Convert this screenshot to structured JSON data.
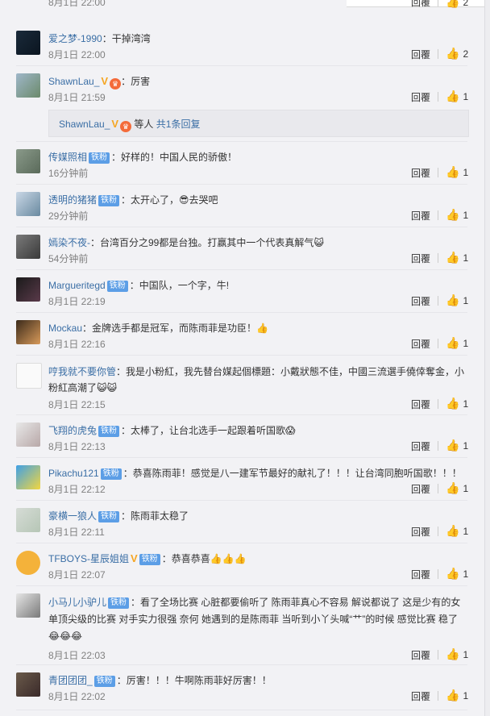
{
  "top_partial": {
    "time": "8月1日 22:00",
    "reply_label": "回覆",
    "like_count": "2"
  },
  "comments": [
    {
      "user": "爱之梦-1990",
      "v": false,
      "crown": false,
      "badge": "",
      "text": "：干掉湾湾",
      "time": "8月1日 22:00",
      "reply": "回覆",
      "likes": "2"
    },
    {
      "user": "ShawnLau_",
      "v": true,
      "crown": true,
      "badge": "",
      "text": "：厉害",
      "time": "8月1日 21:59",
      "reply": "回覆",
      "likes": "1"
    },
    {
      "user": "传媒照相",
      "v": false,
      "crown": false,
      "badge": "铁粉",
      "text": "：好样的！中国人民的骄傲！",
      "time": "16分钟前",
      "reply": "回覆",
      "likes": "1"
    },
    {
      "user": "透明的猪猪",
      "v": false,
      "crown": false,
      "badge": "铁粉",
      "text": "：太开心了，😎去哭吧",
      "time": "29分钟前",
      "reply": "回覆",
      "likes": "1"
    },
    {
      "user": "嫣染不夜-",
      "v": false,
      "crown": false,
      "badge": "",
      "text": "：台湾百分之99都是台独。打赢其中一个代表真解气😺",
      "time": "54分钟前",
      "reply": "回覆",
      "likes": "1"
    },
    {
      "user": "Margueritegd",
      "v": false,
      "crown": false,
      "badge": "铁粉",
      "text": "：中国队，一个字，牛!",
      "time": "8月1日 22:19",
      "reply": "回覆",
      "likes": "1"
    },
    {
      "user": "Mockau",
      "v": false,
      "crown": false,
      "badge": "",
      "text": "：金牌选手都是冠军，而陈雨菲是功臣！👍",
      "time": "8月1日 22:16",
      "reply": "回覆",
      "likes": "1"
    },
    {
      "user": "哼我就不要你管",
      "v": false,
      "crown": false,
      "badge": "",
      "text": "：我是小粉紅，我先替台媒起個標題：小戴狀態不佳，中國三流選手僥倖奪金，小粉紅高潮了😺😺",
      "time": "8月1日 22:15",
      "reply": "回覆",
      "likes": "1"
    },
    {
      "user": "飞翔的虎兔",
      "v": false,
      "crown": false,
      "badge": "铁粉",
      "text": "：太棒了，让台北选手一起跟着听国歌😱",
      "time": "8月1日 22:13",
      "reply": "回覆",
      "likes": "1"
    },
    {
      "user": "Pikachu121",
      "v": false,
      "crown": false,
      "badge": "铁粉",
      "text": "：恭喜陈雨菲！感觉是八一建军节最好的献礼了！！！让台湾同胞听国歌！！！",
      "time": "8月1日 22:12",
      "reply": "回覆",
      "likes": "1"
    },
    {
      "user": "豪横一狼人",
      "v": false,
      "crown": false,
      "badge": "铁粉",
      "text": "：陈雨菲太稳了",
      "time": "8月1日 22:11",
      "reply": "回覆",
      "likes": "1"
    },
    {
      "user": "TFBOYS-星辰姐姐",
      "v": true,
      "crown": false,
      "badge": "铁粉",
      "text": "：恭喜恭喜👍👍👍",
      "time": "8月1日 22:07",
      "reply": "回覆",
      "likes": "1"
    },
    {
      "user": "小马儿小驴儿",
      "v": false,
      "crown": false,
      "badge": "铁粉",
      "text": "：看了全场比赛 心脏都要偷听了 陈雨菲真心不容易 解说都说了 这是少有的女单顶尖级的比赛 对手实力很强 奈何 她遇到的是陈雨菲 当听到小丫头喊“艹”的时候 感觉比赛 稳了😂😂😂",
      "time": "8月1日 22:03",
      "reply": "回覆",
      "likes": "1"
    },
    {
      "user": "青团团团_",
      "v": false,
      "crown": false,
      "badge": "铁粉",
      "text": "：厉害！！！牛啊陈雨菲好厉害！！",
      "time": "8月1日 22:02",
      "reply": "回覆",
      "likes": "1"
    }
  ],
  "sub_reply": {
    "user": "ShawnLau_",
    "text": "等人",
    "link": "共1条回复"
  },
  "icons": {
    "like": "thumbs-up-icon",
    "verified": "v-badge-icon",
    "crown": "crown-badge-icon"
  }
}
